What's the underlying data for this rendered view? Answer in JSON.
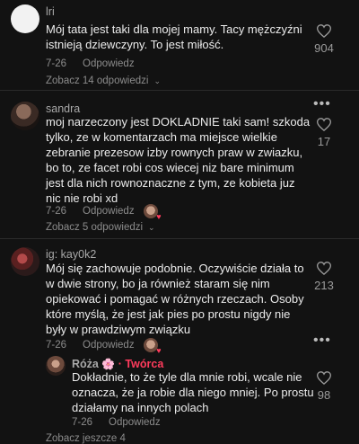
{
  "comments": [
    {
      "username": "lri",
      "text_lines": [
        "Mój tata jest taki dla mojej mamy. Tacy mężczyźni",
        "istnieją dziewczyny. To jest miłość."
      ],
      "date": "7-26",
      "reply_label": "Odpowiedz",
      "likes": "904",
      "view_replies": "Zobacz 14 odpowiedzi"
    },
    {
      "username": "sandra",
      "text_lines": [
        "moj narzeczony jest DOKLADNIE taki sam! szkoda",
        "tylko, ze w komentarzach ma miejsce wielkie",
        "zebranie prezesow izby rownych praw w zwiazku,",
        "bo to, ze facet robi cos wiecej niz bare minimum",
        "jest dla nich rownoznaczne z tym, ze kobieta juz",
        "nic nie robi xd"
      ],
      "date": "7-26",
      "reply_label": "Odpowiedz",
      "likes": "17",
      "view_replies": "Zobacz 5 odpowiedzi"
    },
    {
      "username": "ig: kay0k2",
      "text_lines": [
        "Mój się zachowuje podobnie. Oczywiście działa to",
        "w dwie strony, bo ja również staram się nim",
        "opiekować i pomagać w różnych rzeczach. Osoby",
        "które myślą, że jest jak pies po prostu nigdy nie",
        "były w prawdziwym związku"
      ],
      "date": "7-26",
      "reply_label": "Odpowiedz",
      "likes": "213"
    }
  ],
  "reply": {
    "username": "Róża",
    "emoji": "🌸",
    "badge": "· Twórca",
    "text_lines": [
      "Dokładnie, to że tyle dla mnie robi, wcale nie",
      "oznacza, że ja robie dla niego mniej. Po prostu",
      "działamy na innych polach"
    ],
    "date": "7-26",
    "reply_label": "Odpowiedz",
    "likes": "98"
  },
  "footer": {
    "partial_text": "Zobacz jeszcze 4"
  },
  "colors": {
    "background": "#121212",
    "creator": "#ff3b5c"
  }
}
